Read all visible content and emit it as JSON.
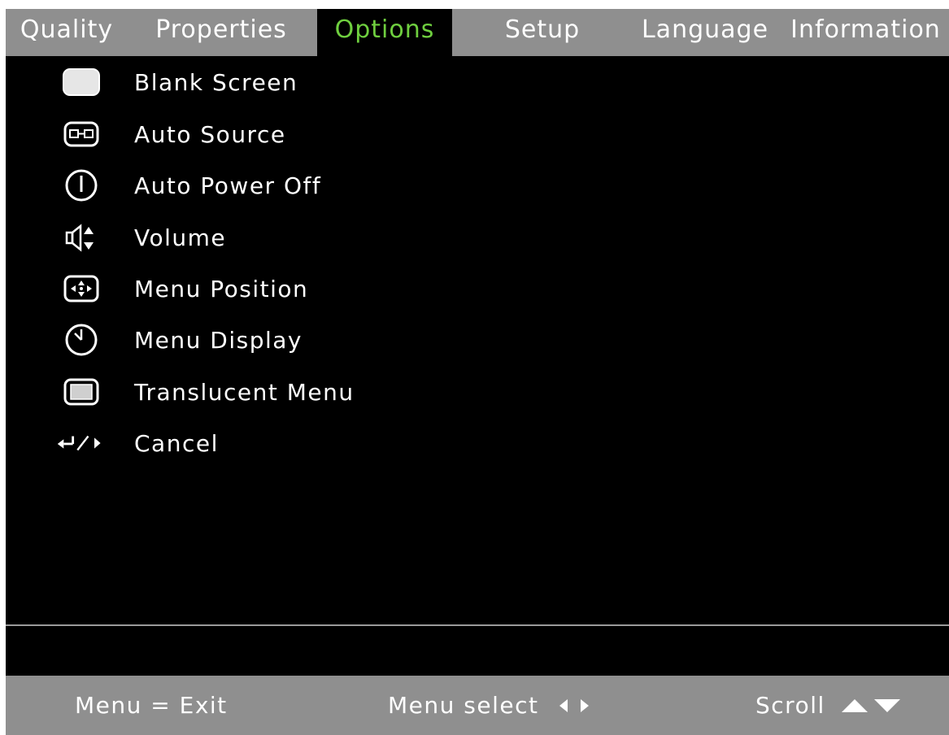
{
  "tabs": [
    {
      "label": "Quality"
    },
    {
      "label": "Properties"
    },
    {
      "label": "Options",
      "active": true
    },
    {
      "label": "Setup"
    },
    {
      "label": "Language"
    },
    {
      "label": "Information"
    }
  ],
  "menu_items": [
    {
      "label": "Blank Screen",
      "icon": "blank-screen-icon"
    },
    {
      "label": "Auto Source",
      "icon": "auto-source-icon"
    },
    {
      "label": "Auto Power Off",
      "icon": "power-icon"
    },
    {
      "label": "Volume",
      "icon": "volume-icon"
    },
    {
      "label": "Menu Position",
      "icon": "menu-position-icon"
    },
    {
      "label": "Menu Display",
      "icon": "clock-icon"
    },
    {
      "label": "Translucent Menu",
      "icon": "translucent-menu-icon"
    },
    {
      "label": "Cancel",
      "icon": "enter-back-icon"
    }
  ],
  "footer": {
    "exit_hint": "Menu = Exit",
    "select_hint": "Menu select",
    "select_icon": "left-right-arrows-icon",
    "scroll_hint": "Scroll",
    "scroll_icon": "up-down-arrows-icon"
  },
  "colors": {
    "active_tab_text": "#6fcf3f",
    "bar_background": "#8f8f8f",
    "menu_background": "#000000",
    "text": "#ffffff"
  }
}
